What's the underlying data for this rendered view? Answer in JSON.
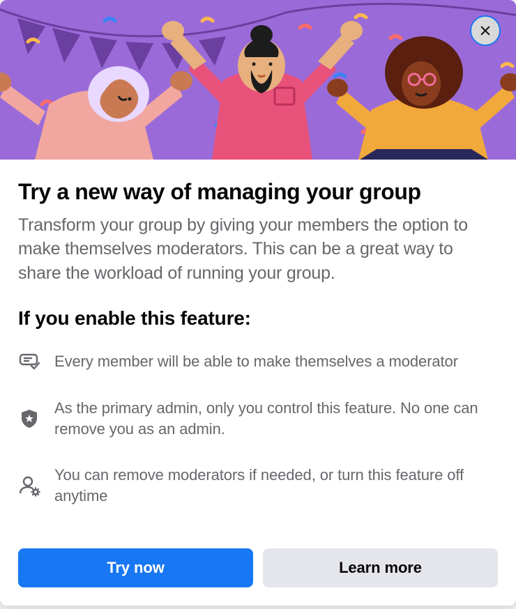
{
  "modal": {
    "title": "Try a new way of managing your group",
    "description": "Transform your group by giving your members the option to make themselves moderators. This can be a great way to share the workload of running your group.",
    "subtitle": "If you enable this feature:",
    "features": [
      {
        "icon": "message-check-icon",
        "text": "Every member will be able to make themselves a moderator"
      },
      {
        "icon": "shield-star-icon",
        "text": "As the primary admin, only you control this feature. No one can remove you as an admin."
      },
      {
        "icon": "user-gear-icon",
        "text": "You can remove moderators if needed, or turn this feature off anytime"
      }
    ],
    "buttons": {
      "primary_label": "Try now",
      "secondary_label": "Learn more"
    },
    "close_label": "Close"
  }
}
